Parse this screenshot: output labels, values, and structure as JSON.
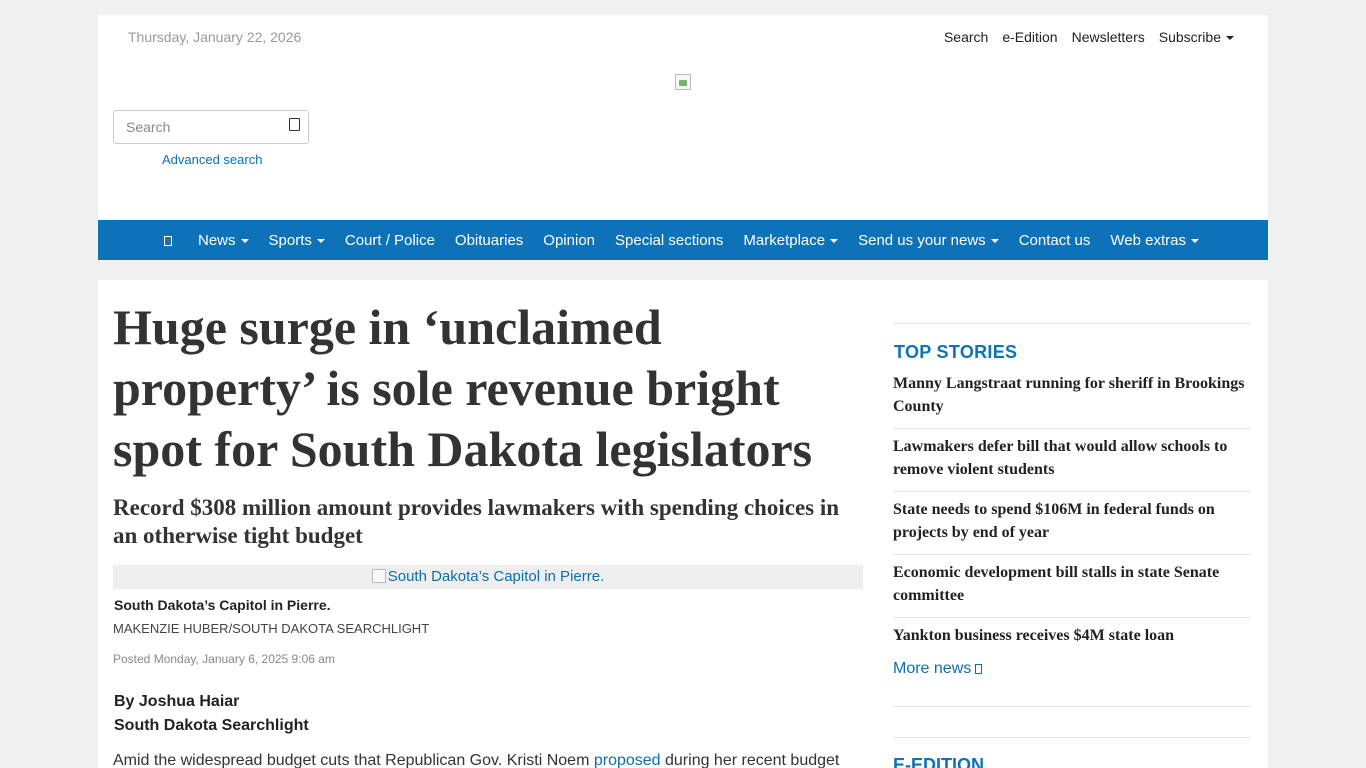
{
  "header": {
    "date": "Thursday, January 22, 2026",
    "links": [
      "Search",
      "e-Edition",
      "Newsletters"
    ],
    "subscribe": "Subscribe",
    "search_placeholder": "Search",
    "advanced_search": "Advanced search"
  },
  "nav": {
    "items": [
      "News",
      "Sports",
      "Court / Police",
      "Obituaries",
      "Opinion",
      "Special sections",
      "Marketplace",
      "Send us your news",
      "Contact us",
      "Web extras"
    ]
  },
  "article": {
    "headline": "Huge surge in ‘unclaimed property’ is sole revenue bright spot for South Dakota legislators",
    "subhead": "Record $308 million amount provides lawmakers with spending choices in an otherwise tight budget",
    "photo_alt": "South Dakota’s Capitol in Pierre.",
    "caption": "South Dakota’s Capitol in Pierre.",
    "credit": "Makenzie Huber/South Dakota Searchlight",
    "posted": "Posted Monday, January 6, 2025 9:06 am",
    "author": "By Joshua Haiar",
    "outlet": "South Dakota Searchlight",
    "body_start": "Amid the widespread budget cuts that Republican Gov. Kristi Noem ",
    "body_link": "proposed",
    "body_end": " during her recent budget"
  },
  "sidebar": {
    "title": "TOP STORIES",
    "stories": [
      "Manny Langstraat running for sheriff in Brookings County",
      "Lawmakers defer bill that would allow schools to remove violent students",
      "State needs to spend $106M in federal funds on projects by end of year",
      "Economic development bill stalls in state Senate committee",
      "Yankton business receives $4M state loan"
    ],
    "more_news": "More news",
    "eedition_title": "E-EDITION"
  }
}
